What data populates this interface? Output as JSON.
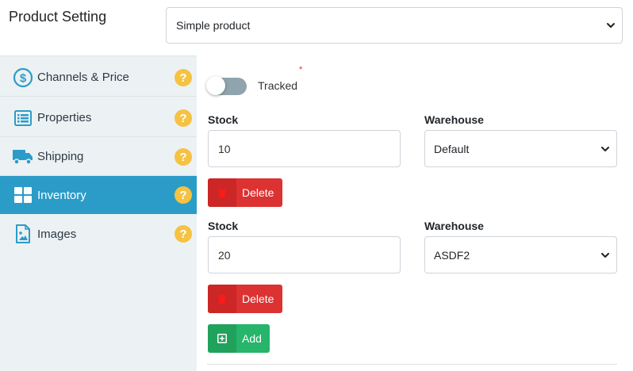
{
  "header": {
    "title": "Product Setting",
    "product_type": "Simple product"
  },
  "sidebar": {
    "items": [
      {
        "label": "Channels & Price",
        "icon": "dollar-circle-icon",
        "active": false
      },
      {
        "label": "Properties",
        "icon": "list-icon",
        "active": false
      },
      {
        "label": "Shipping",
        "icon": "truck-icon",
        "active": false
      },
      {
        "label": "Inventory",
        "icon": "grid-icon",
        "active": true
      },
      {
        "label": "Images",
        "icon": "image-file-icon",
        "active": false
      }
    ],
    "help_icon": "question-circle-icon"
  },
  "inventory": {
    "tracked_label": "Tracked",
    "tracked": false,
    "required_marker": "*",
    "rows": [
      {
        "stock_label": "Stock",
        "stock": "10",
        "warehouse_label": "Warehouse",
        "warehouse": "Default",
        "delete_label": "Delete"
      },
      {
        "stock_label": "Stock",
        "stock": "20",
        "warehouse_label": "Warehouse",
        "warehouse": "ASDF2",
        "delete_label": "Delete"
      }
    ],
    "add_label": "Add"
  },
  "colors": {
    "accent": "#2b9cc8",
    "sidebar_bg": "#ecf1f4",
    "delete": "#dc3232",
    "add": "#26b56a",
    "help": "#f5c242",
    "icon": "#2b9cc8"
  }
}
